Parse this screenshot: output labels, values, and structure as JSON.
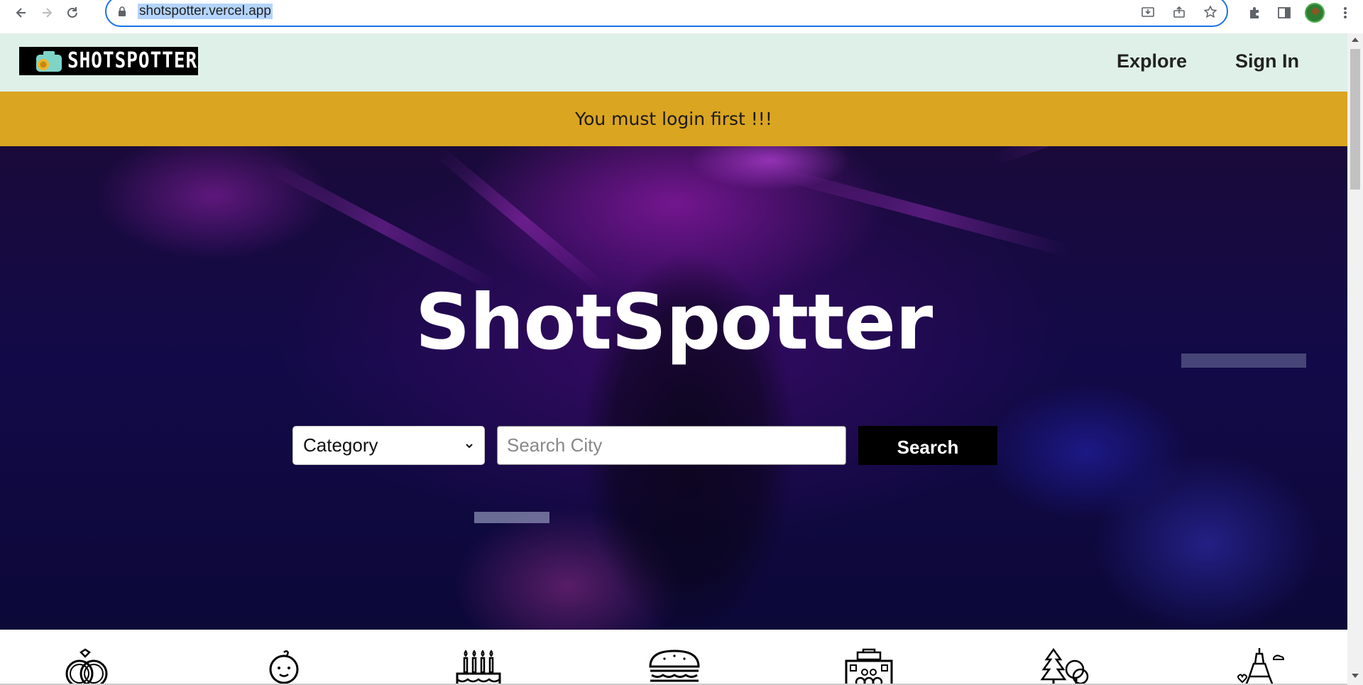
{
  "browser": {
    "url": "shotspotter.vercel.app"
  },
  "site": {
    "logo_text": "SHOTSPOTTER",
    "nav": {
      "explore": "Explore",
      "sign_in": "Sign In"
    },
    "alert": "You must login first !!!",
    "hero": {
      "title": "ShotSpotter",
      "category_select": "Category",
      "city_placeholder": "Search City",
      "search_button": "Search"
    },
    "categories": [
      {
        "icon": "wedding-rings-icon"
      },
      {
        "icon": "baby-icon"
      },
      {
        "icon": "birthday-cake-icon"
      },
      {
        "icon": "burger-icon"
      },
      {
        "icon": "building-icon"
      },
      {
        "icon": "trees-icon"
      },
      {
        "icon": "eiffel-tower-icon"
      }
    ]
  }
}
